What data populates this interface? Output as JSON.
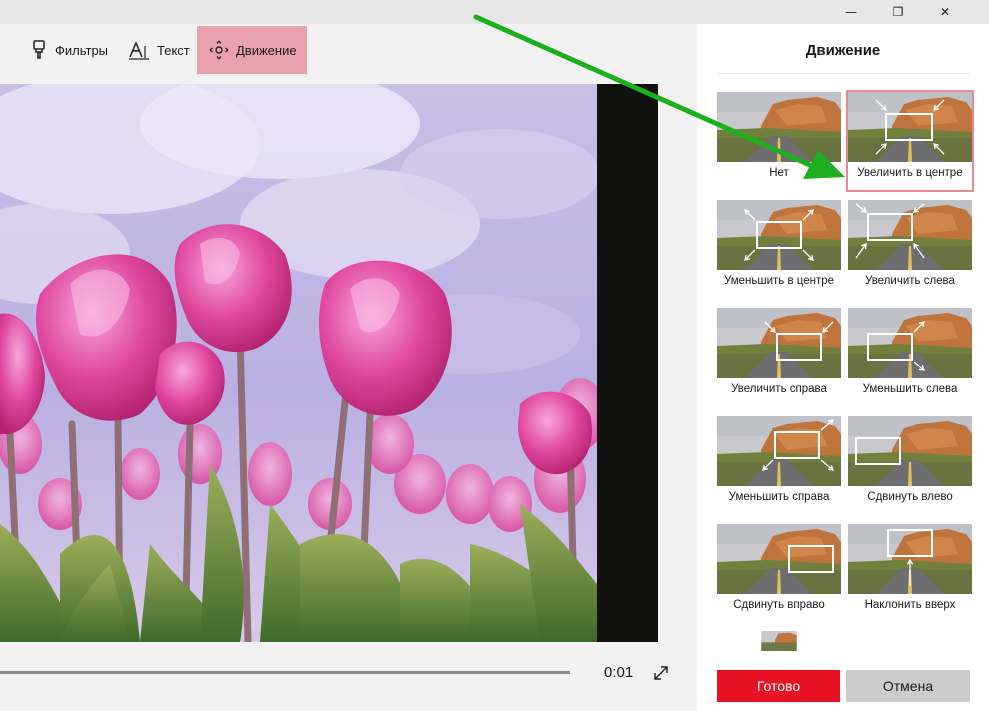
{
  "window": {
    "minimize_glyph": "—",
    "maximize_glyph": "❐",
    "close_glyph": "✕"
  },
  "toolbar": {
    "filters_label": "Фильтры",
    "text_label": "Текст",
    "motion_label": "Движение",
    "filters_icon": "brush-icon",
    "text_icon": "text-icon",
    "motion_icon": "move-icon",
    "active_color": "#e9a2ab"
  },
  "preview": {
    "time": "0:01",
    "expand_icon": "expand-diagonal-icon"
  },
  "panel": {
    "title": "Движение",
    "motions": [
      {
        "label": "Нет",
        "overlay": "none",
        "selected": false
      },
      {
        "label": "Увеличить в центре",
        "overlay": "zoom-in-center",
        "selected": true
      },
      {
        "label": "Уменьшить в центре",
        "overlay": "zoom-out-center",
        "selected": false
      },
      {
        "label": "Увеличить слева",
        "overlay": "zoom-in-left",
        "selected": false
      },
      {
        "label": "Увеличить справа",
        "overlay": "zoom-in-right",
        "selected": false
      },
      {
        "label": "Уменьшить слева",
        "overlay": "zoom-out-left",
        "selected": false
      },
      {
        "label": "Уменьшить справа",
        "overlay": "zoom-out-right",
        "selected": false
      },
      {
        "label": "Сдвинуть влево",
        "overlay": "pan-left",
        "selected": false
      },
      {
        "label": "Сдвинуть вправо",
        "overlay": "pan-right",
        "selected": false
      },
      {
        "label": "Наклонить вверх",
        "overlay": "tilt-up",
        "selected": false
      }
    ],
    "ok_label": "Готово",
    "cancel_label": "Отмена",
    "accent_color": "#e81123",
    "selected_outline": "#e88a96"
  },
  "annotation": {
    "arrow_color": "#1fae1f"
  }
}
